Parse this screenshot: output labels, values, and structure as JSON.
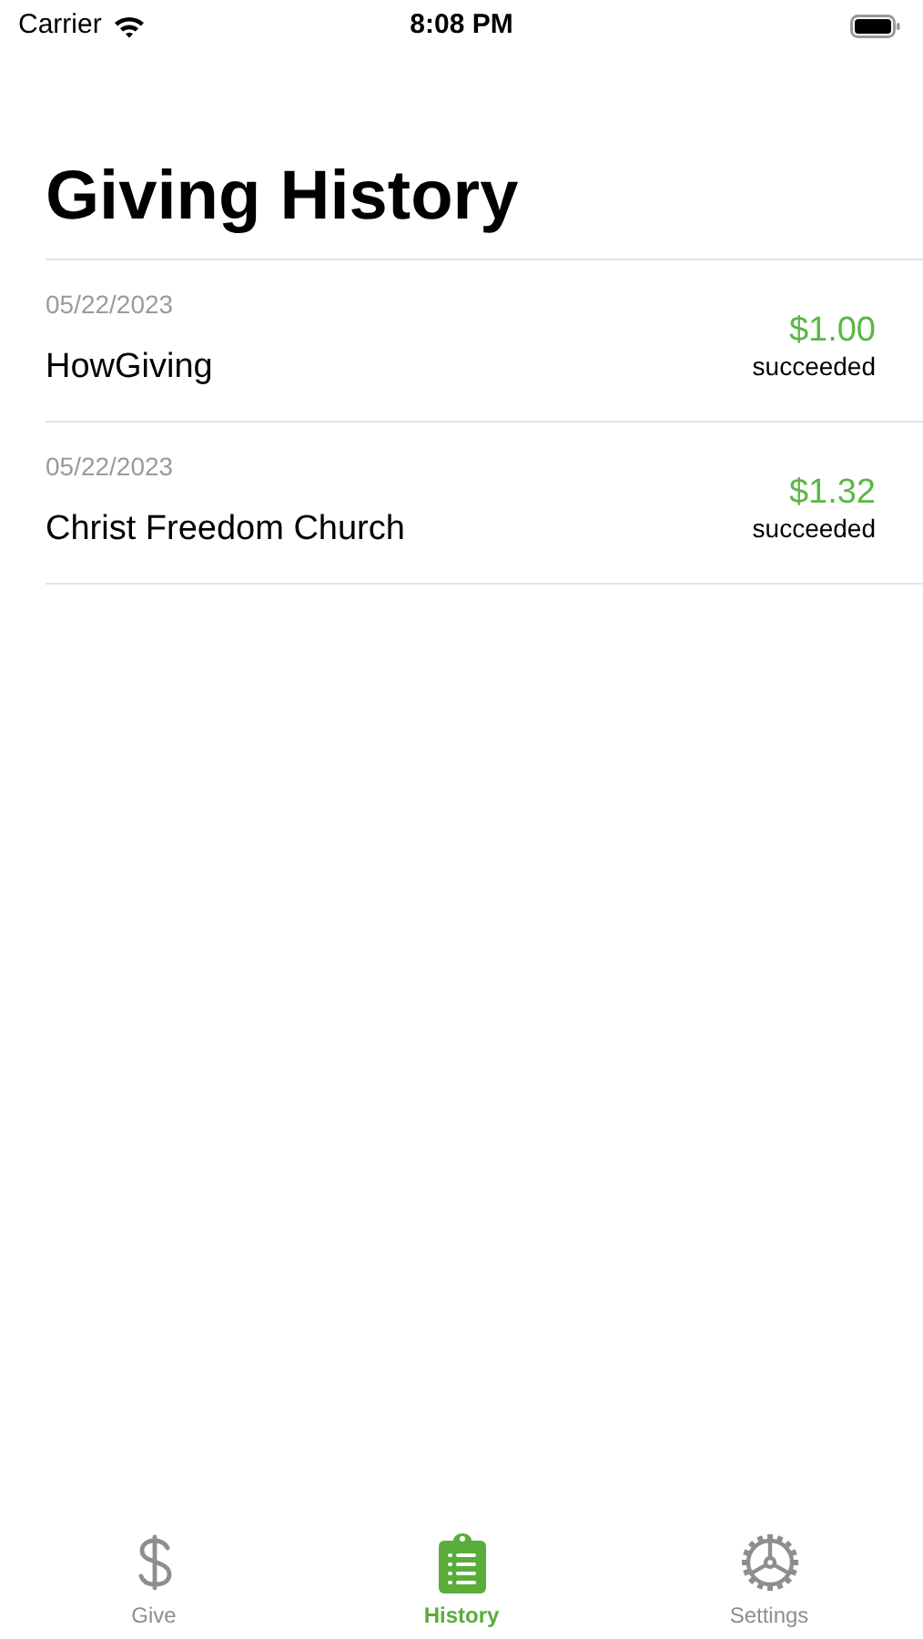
{
  "status_bar": {
    "carrier": "Carrier",
    "time": "8:08 PM"
  },
  "title": "Giving History",
  "donations": [
    {
      "date": "05/22/2023",
      "recipient": "HowGiving",
      "amount": "$1.00",
      "status": "succeeded"
    },
    {
      "date": "05/22/2023",
      "recipient": "Christ Freedom Church",
      "amount": "$1.32",
      "status": "succeeded"
    }
  ],
  "tabs": [
    {
      "label": "Give",
      "selected": false
    },
    {
      "label": "History",
      "selected": true
    },
    {
      "label": "Settings",
      "selected": false
    }
  ]
}
